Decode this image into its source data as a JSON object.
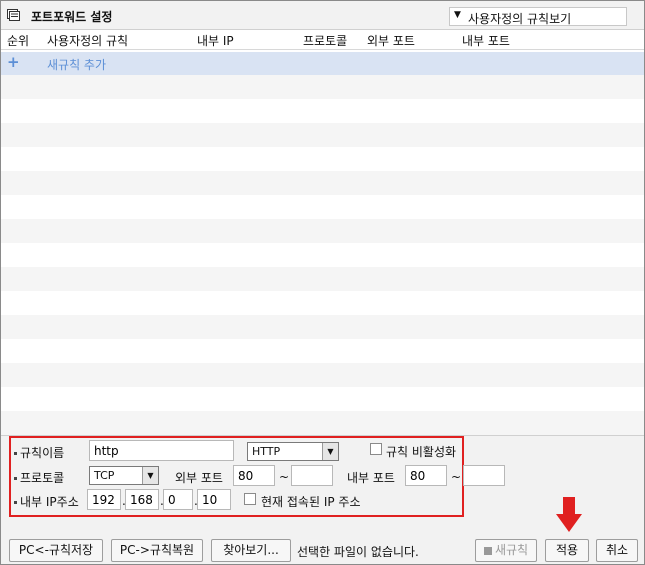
{
  "title": {
    "text": "포트포워드 설정"
  },
  "view_select": {
    "value": "사용자정의 규칙보기"
  },
  "table": {
    "headers": [
      "순위",
      "사용자정의 규칙",
      "내부 IP",
      "프로토콜",
      "외부 포트",
      "내부 포트"
    ],
    "add_row_label": "새규칙 추가",
    "add_row_icon": "+"
  },
  "form": {
    "rule_name_label": "규칙이름",
    "rule_name_value": "http",
    "service_select_value": "HTTP",
    "disable_rule_label": "규칙 비활성화",
    "protocol_label": "프로토콜",
    "protocol_value": "TCP",
    "external_port_label": "외부 포트",
    "external_port_from": "80",
    "external_port_to": "",
    "internal_port_label": "내부 포트",
    "internal_port_from": "80",
    "internal_port_to": "",
    "tilde": "~",
    "internal_ip_label": "내부 IP주소",
    "ip_octets": [
      "192",
      "168",
      "0",
      "10"
    ],
    "ip_dot": ".",
    "current_ip_label": "현재 접속된 IP 주소"
  },
  "buttons": {
    "save_to_pc": "PC<-규칙저장",
    "restore_from_pc": "PC->규칙복원",
    "browse": "찾아보기...",
    "no_file_text": "선택한 파일이 없습니다.",
    "new_rule": "새규칙",
    "apply": "적용",
    "cancel": "취소"
  },
  "colors": {
    "accent": "#5c8fd6",
    "highlight_box": "#e02020",
    "pointer_arrow": "#e02020"
  }
}
